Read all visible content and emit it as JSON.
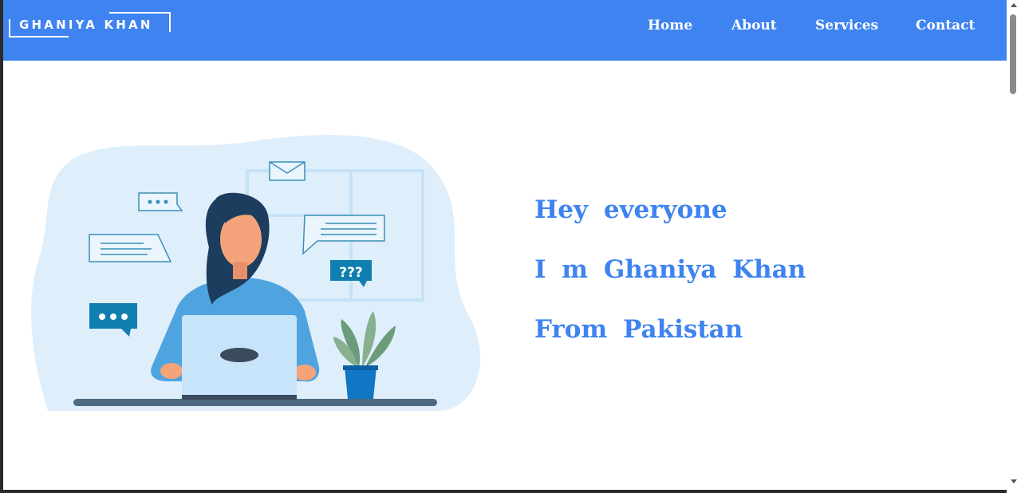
{
  "brand": {
    "logo_text": "GHANIYA KHAN"
  },
  "nav": {
    "home": "Home",
    "about": "About",
    "services": "Services",
    "contact": "Contact"
  },
  "hero": {
    "line1": "Hey everyone",
    "line2": "I m Ghaniya Khan",
    "line3": "From Pakistan",
    "illustration_badge": "???"
  },
  "colors": {
    "accent": "#3e83f0",
    "background": "#ffffff",
    "text_on_accent": "#ffffff"
  }
}
